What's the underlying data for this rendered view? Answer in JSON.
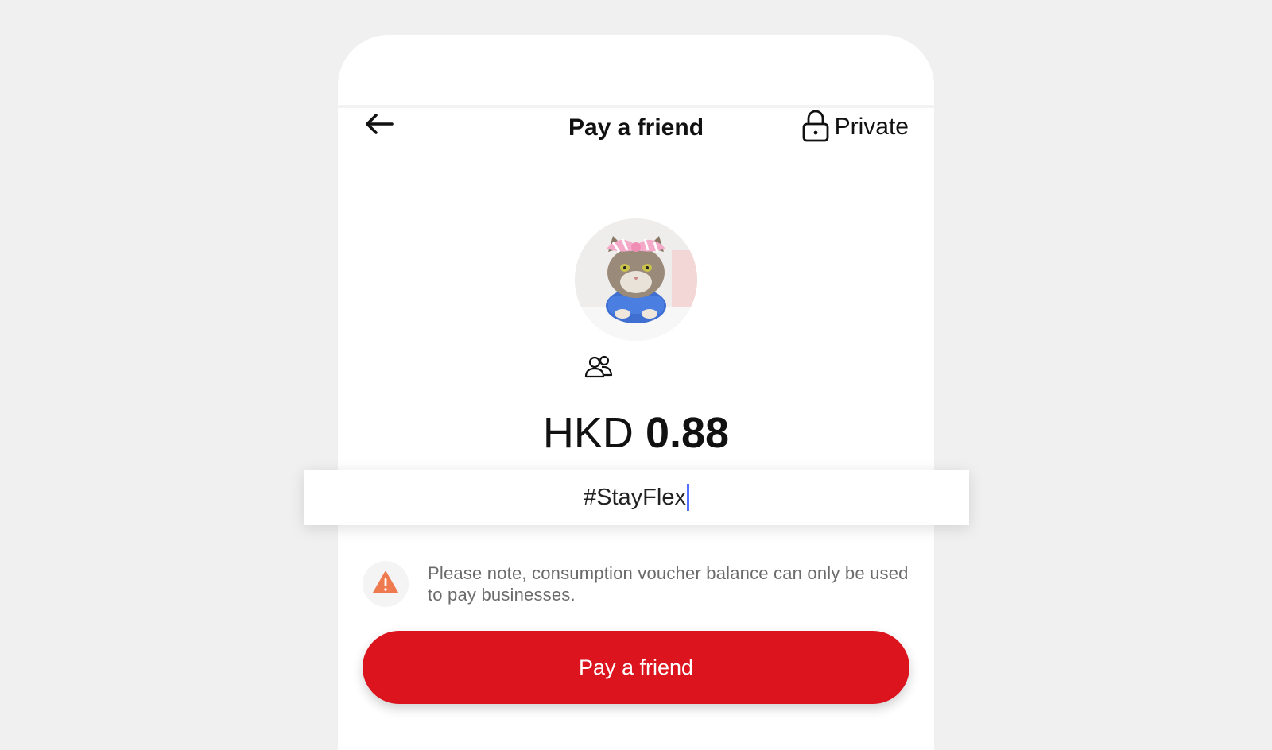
{
  "header": {
    "title": "Pay a friend",
    "back_icon": "arrow-left-icon",
    "privacy_label": "Private",
    "privacy_icon": "lock-icon"
  },
  "recipient": {
    "avatar": "cat-avatar",
    "group_icon": "group-icon"
  },
  "payment": {
    "currency": "HKD",
    "amount": "0.88"
  },
  "message": {
    "value": "#StayFlex"
  },
  "notice": {
    "icon": "warning-icon",
    "text": "Please note, consumption voucher balance can only be used to pay businesses."
  },
  "actions": {
    "pay_label": "Pay a friend"
  },
  "colors": {
    "primary": "#dc141e",
    "warning": "#f07a50",
    "caret": "#5470ff",
    "background": "#f0f0f0"
  }
}
